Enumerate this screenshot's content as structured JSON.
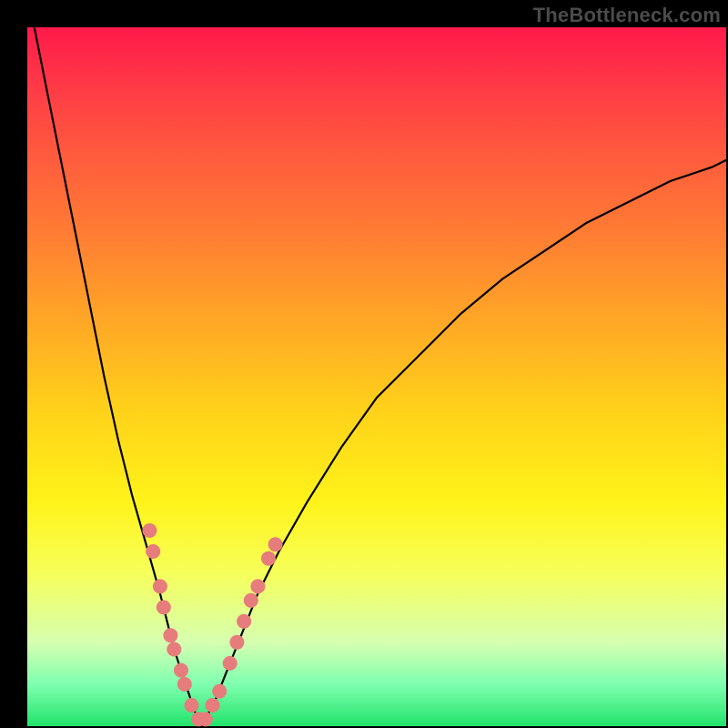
{
  "watermark": "TheBottleneck.com",
  "colors": {
    "frame": "#000000",
    "gradient_top": "#ff1a4b",
    "gradient_bottom": "#22e36b",
    "curve": "#000000",
    "dots": "#e77c7c"
  },
  "chart_data": {
    "type": "line",
    "title": "",
    "xlabel": "",
    "ylabel": "",
    "xlim": [
      0,
      100
    ],
    "ylim": [
      0,
      100
    ],
    "grid": false,
    "legend": false,
    "notes": "Two black curves descend from top-left and top-right toward a common minimum near x≈25, y≈0. Pink dots cluster along the lower portions of both curves near the minimum. Background is a vertical red→yellow→green gradient. No axis ticks or labels are shown.",
    "series": [
      {
        "name": "left-curve",
        "x": [
          1,
          3,
          5,
          7,
          9,
          11,
          13,
          15,
          17,
          19,
          20,
          21,
          22,
          23,
          24,
          25
        ],
        "y": [
          100,
          90,
          80,
          70,
          60,
          50,
          41,
          33,
          26,
          19,
          15,
          11,
          8,
          5,
          2,
          0
        ]
      },
      {
        "name": "right-curve",
        "x": [
          25,
          27,
          29,
          31,
          33,
          36,
          40,
          45,
          50,
          56,
          62,
          68,
          74,
          80,
          86,
          92,
          98,
          100
        ],
        "y": [
          0,
          4,
          9,
          14,
          19,
          25,
          32,
          40,
          47,
          53,
          59,
          64,
          68,
          72,
          75,
          78,
          80,
          81
        ]
      }
    ],
    "dots": [
      {
        "x": 17.5,
        "y": 28
      },
      {
        "x": 18.0,
        "y": 25
      },
      {
        "x": 19.0,
        "y": 20
      },
      {
        "x": 19.5,
        "y": 17
      },
      {
        "x": 20.5,
        "y": 13
      },
      {
        "x": 21.0,
        "y": 11
      },
      {
        "x": 22.0,
        "y": 8
      },
      {
        "x": 22.5,
        "y": 6
      },
      {
        "x": 23.5,
        "y": 3
      },
      {
        "x": 24.5,
        "y": 1
      },
      {
        "x": 25.5,
        "y": 1
      },
      {
        "x": 26.5,
        "y": 3
      },
      {
        "x": 27.5,
        "y": 5
      },
      {
        "x": 29.0,
        "y": 9
      },
      {
        "x": 30.0,
        "y": 12
      },
      {
        "x": 31.0,
        "y": 15
      },
      {
        "x": 32.0,
        "y": 18
      },
      {
        "x": 33.0,
        "y": 20
      },
      {
        "x": 34.5,
        "y": 24
      },
      {
        "x": 35.5,
        "y": 26
      }
    ]
  }
}
